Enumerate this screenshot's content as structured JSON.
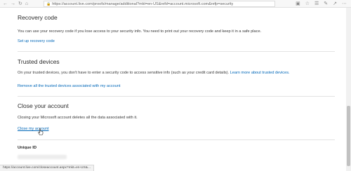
{
  "browser": {
    "url": "https://account.live.com/proofs/manage/additional?mkt=en-US&refd=account.microsoft.com&refp=security",
    "status_url": "https://account.live.com/closeaccount.aspx?mkt=en-US&..."
  },
  "recovery": {
    "title": "Recovery code",
    "description": "You can use your recovery code if you lose access to your security info. You need to print out your recovery code and keep it in a safe place.",
    "link": "Set up recovery code"
  },
  "trusted": {
    "title": "Trusted devices",
    "description": "On your trusted devices, you don't have to enter a security code to access sensitive info (such as your credit card details).",
    "learn_more": "Learn more about trusted devices.",
    "remove_link": "Remove all the trusted devices associated with my account"
  },
  "close": {
    "title": "Close your account",
    "description": "Closing your Microsoft account deletes all the data associated with it.",
    "link": "Close my account"
  },
  "unique_id": {
    "label": "Unique ID"
  },
  "colors": {
    "link": "#0067b8",
    "text": "#262626",
    "divider": "#e3e3e3"
  }
}
